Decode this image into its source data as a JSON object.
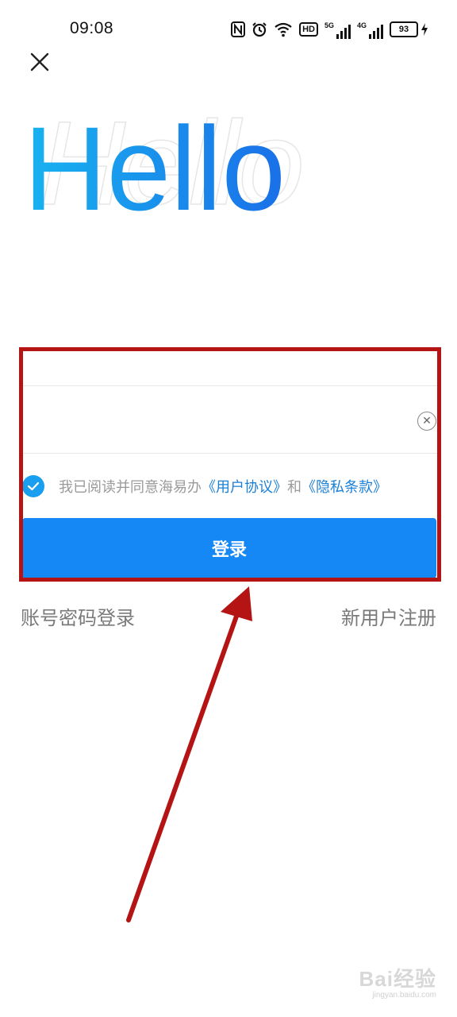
{
  "status_bar": {
    "time": "09:08",
    "hd_label": "HD",
    "net1_label": "5G",
    "net2_label": "4G",
    "battery_level": "93"
  },
  "hero": {
    "greeting": "Hello",
    "gradient_start": "#18b3f0",
    "gradient_end": "#1a6fe8"
  },
  "form": {
    "agree_prefix": "我已阅读并同意海易办",
    "user_agreement_link": "《用户协议》",
    "agree_and": "和",
    "privacy_link": "《隐私条款》",
    "login_button": "登录"
  },
  "links": {
    "password_login": "账号密码登录",
    "register": "新用户注册"
  },
  "colors": {
    "primary": "#1588f5",
    "link": "#1a7fd6",
    "annotation_red": "#b41414"
  },
  "watermark": {
    "main": "Bai经验",
    "sub": "jingyan.baidu.com"
  }
}
